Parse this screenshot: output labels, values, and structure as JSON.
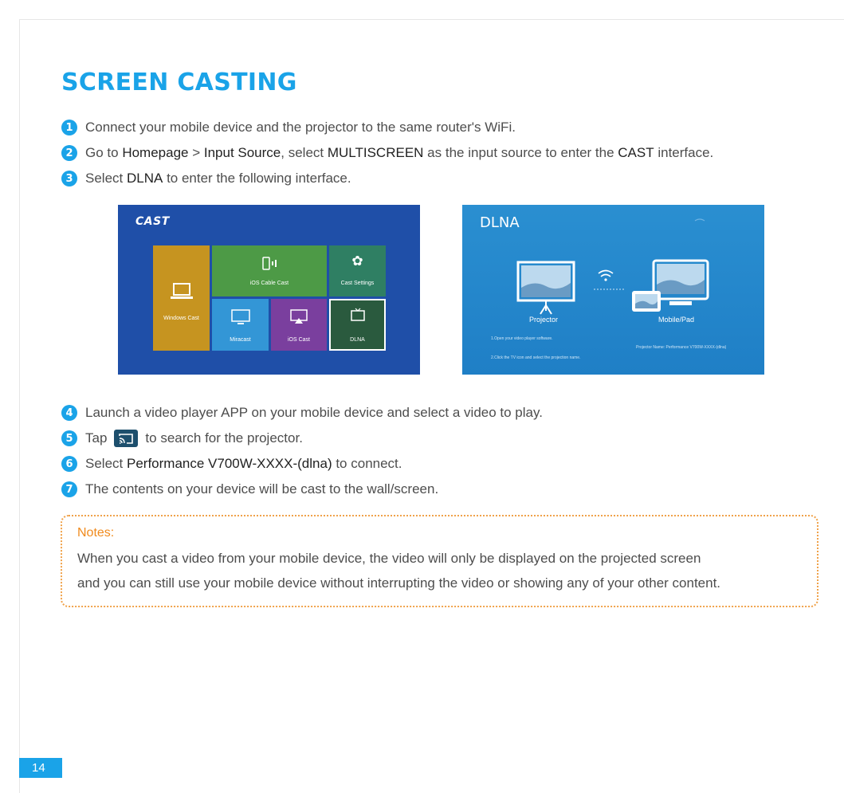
{
  "title": "SCREEN CASTING",
  "steps": [
    {
      "n": "1",
      "text": "Connect your mobile device and the projector to the same router's WiFi."
    },
    {
      "n": "2",
      "t1": "Go to ",
      "b1": "Homepage",
      "t2": " > ",
      "b2": "Input Source",
      "t3": ", select ",
      "b3": "MULTISCREEN",
      "t4": " as the input source to enter the ",
      "b4": "CAST",
      "t5": " interface."
    },
    {
      "n": "3",
      "t1": "Select ",
      "b1": "DLNA",
      "t2": " to enter the following interface."
    },
    {
      "n": "4",
      "text": "Launch a video player APP on your mobile device and select a video to play."
    },
    {
      "n": "5",
      "t1": "Tap",
      "t2": "to search for the projector."
    },
    {
      "n": "6",
      "t1": "Select ",
      "b1": "Performance V700W-XXXX-(dlna)",
      "t2": " to connect."
    },
    {
      "n": "7",
      "text": "The contents on your device will be cast to the wall/screen."
    }
  ],
  "cast_screen": {
    "logo": "CAST",
    "tiles": {
      "windows": "Windows Cast",
      "ios_cable": "iOS Cable Cast",
      "settings": "Cast Settings",
      "miracast": "Miracast",
      "ios_cast": "iOS Cast",
      "dlna": "DLNA"
    },
    "colors": {
      "bg": "#1f4fa8",
      "windows": "#c69420",
      "ios_cable": "#4d9a46",
      "settings": "#2f7f63",
      "miracast": "#3396d6",
      "ios_cast": "#7a3f9e",
      "dlna": "#2a5a3e"
    }
  },
  "dlna_screen": {
    "title": "DLNA",
    "projector_label": "Projector",
    "mobile_label": "Mobile/Pad",
    "instr1": "1.Open your video player software.",
    "instr2": "2.Click the TV icon and select the projection name.",
    "projector_name": "Projector Name: Performance V700W-XXXX-(dlna)"
  },
  "notes": {
    "heading": "Notes:",
    "line1": "When you cast a video from your mobile device, the video will only be displayed on the projected screen",
    "line2": "and you can still use your mobile device without interrupting the video or showing any of your other content."
  },
  "page_number": "14",
  "accent_color": "#1aa3e8",
  "notes_color": "#f08a1c"
}
